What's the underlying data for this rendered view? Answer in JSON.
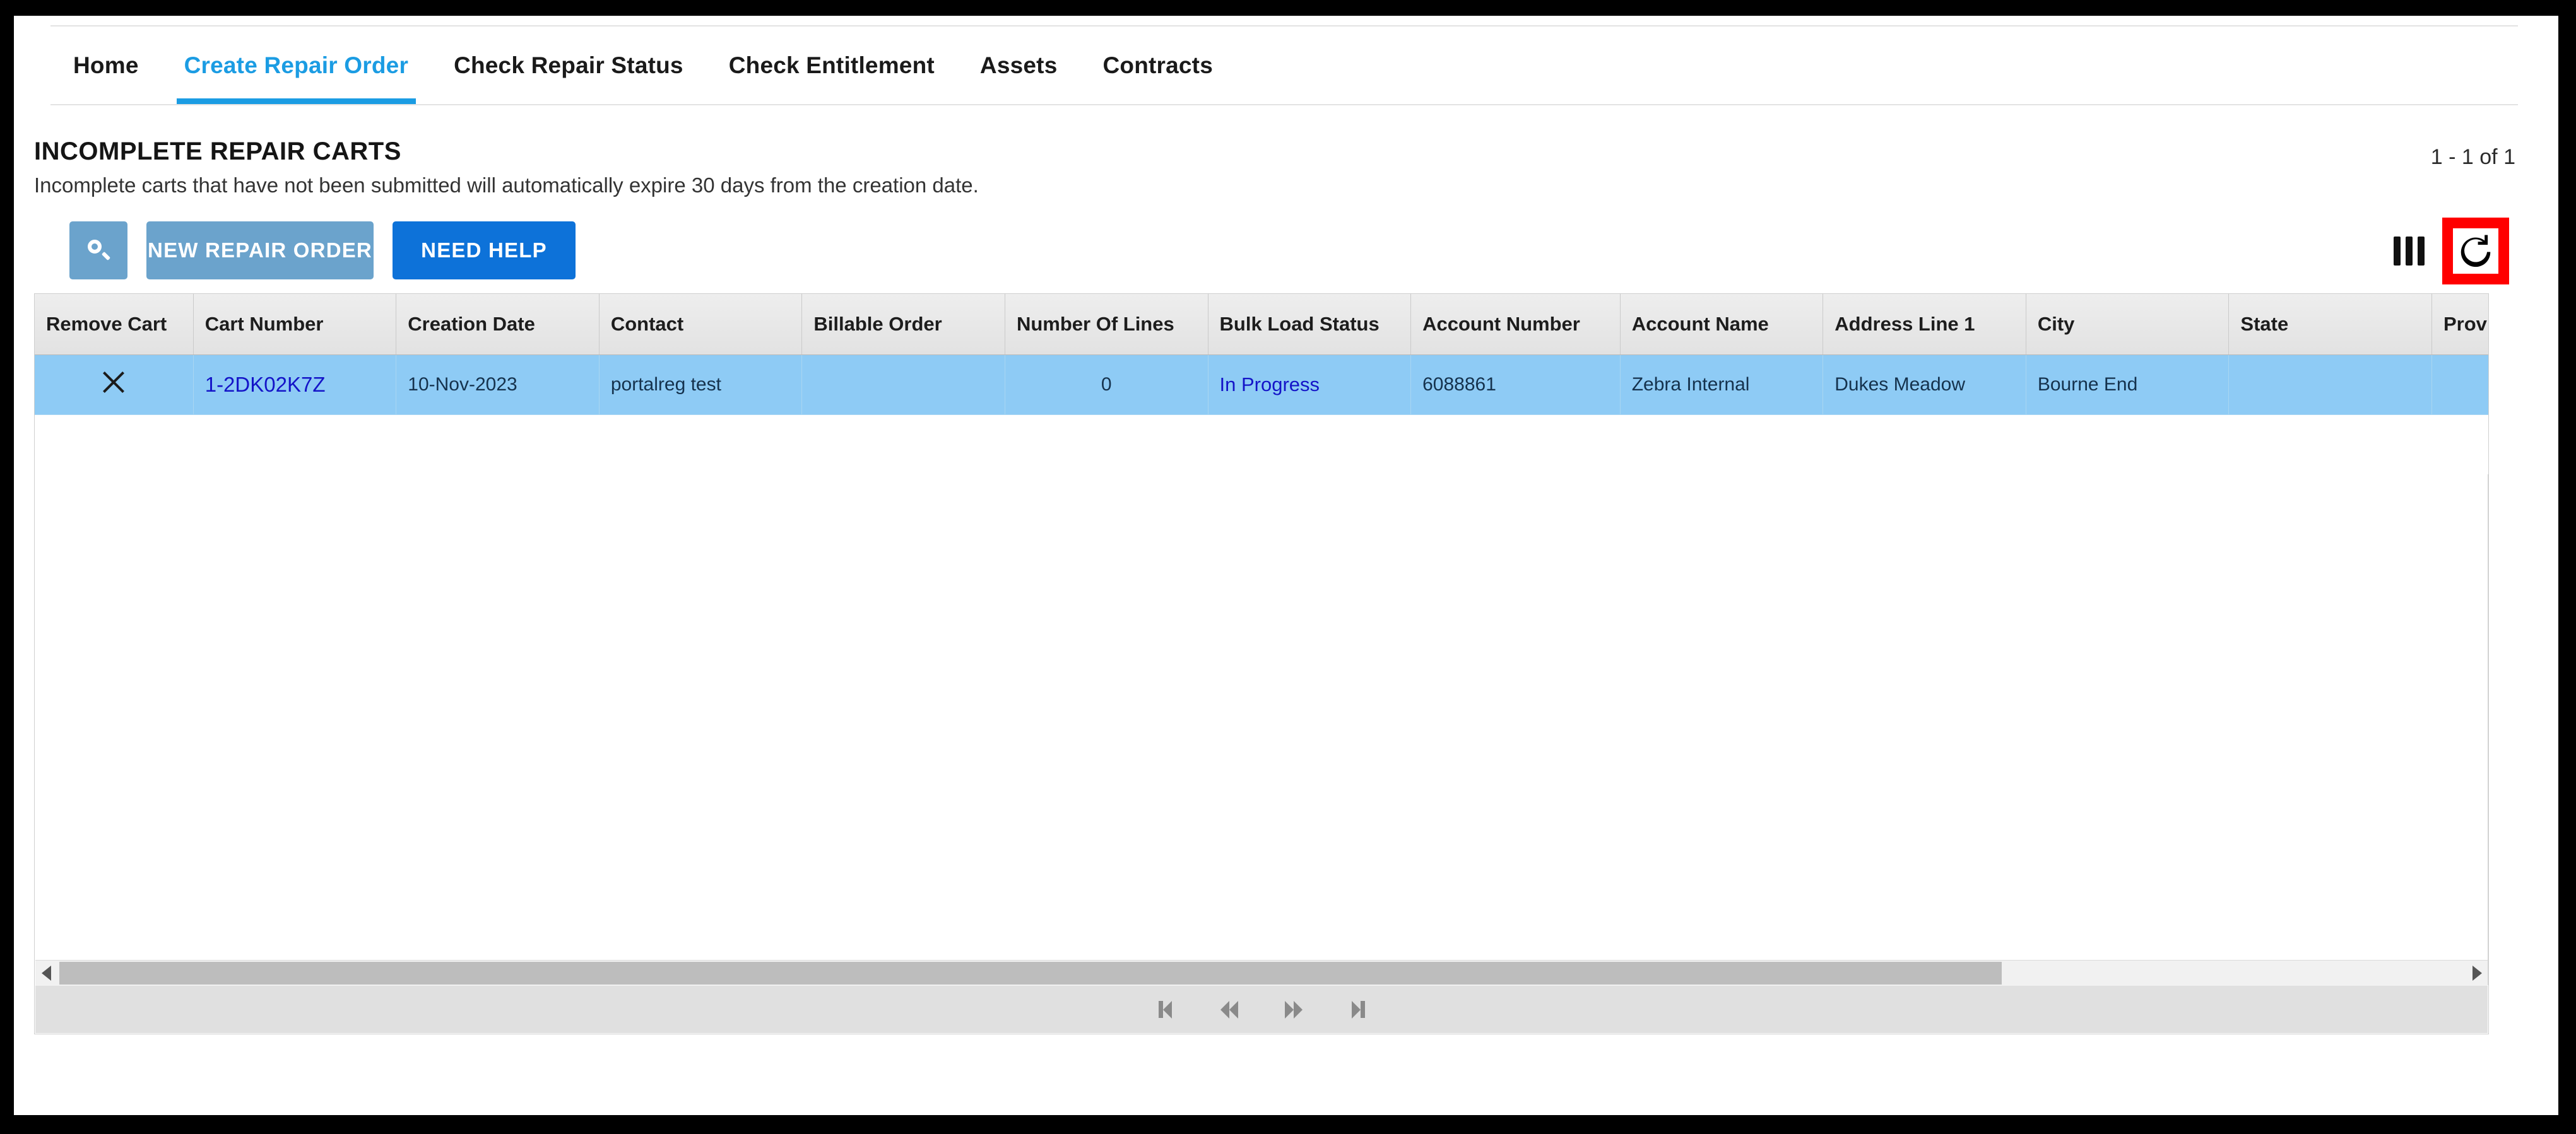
{
  "nav": {
    "tabs": [
      {
        "label": "Home",
        "active": false
      },
      {
        "label": "Create Repair Order",
        "active": true
      },
      {
        "label": "Check Repair Status",
        "active": false
      },
      {
        "label": "Check Entitlement",
        "active": false
      },
      {
        "label": "Assets",
        "active": false
      },
      {
        "label": "Contracts",
        "active": false
      }
    ]
  },
  "header": {
    "title": "INCOMPLETE REPAIR CARTS",
    "subtitle": "Incomplete carts that have not been submitted will automatically expire 30 days from the creation date.",
    "record_count": "1 - 1 of 1"
  },
  "toolbar": {
    "search_icon": "search-icon",
    "new_repair_order_label": "NEW REPAIR ORDER",
    "need_help_label": "NEED HELP",
    "columns_icon": "columns-icon",
    "refresh_icon": "refresh-icon",
    "highlight_color": "#ff0000",
    "primary_button_color": "#0d72d9",
    "muted_button_color": "#6ba3cc"
  },
  "grid": {
    "columns": [
      "Remove Cart",
      "Cart Number",
      "Creation Date",
      "Contact",
      "Billable Order",
      "Number Of Lines",
      "Bulk Load Status",
      "Account Number",
      "Account Name",
      "Address Line 1",
      "City",
      "State",
      "Prov"
    ],
    "rows": [
      {
        "remove_cart": "remove-icon",
        "cart_number": "1-2DK02K7Z",
        "creation_date": "10-Nov-2023",
        "contact": "portalreg test",
        "billable_order": "",
        "number_of_lines": "0",
        "bulk_load_status": "In Progress",
        "account_number": "6088861",
        "account_name": "Zebra Internal",
        "address_line_1": "Dukes Meadow",
        "city": "Bourne End",
        "state": "",
        "prov": "",
        "selected": true,
        "row_color": "#8ecbf5",
        "link_color": "#1414c8"
      }
    ]
  },
  "pagination": {
    "first_label": "first-page",
    "prev_label": "previous-page",
    "next_label": "next-page",
    "last_label": "last-page"
  },
  "scrollbar": {
    "left_arrow": "scroll-left-arrow",
    "right_arrow": "scroll-right-arrow"
  }
}
